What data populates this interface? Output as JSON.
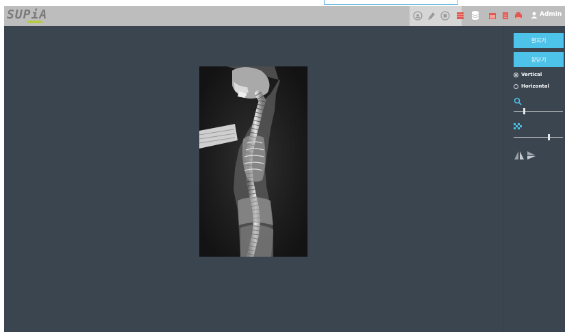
{
  "app": {
    "logo_text": "SUPiA"
  },
  "header": {
    "user_label": "Admin",
    "icons": [
      "eject-icon",
      "eraser-icon",
      "stop-icon",
      "film-icon",
      "database-icon",
      "calendar-icon",
      "document-icon",
      "print-icon",
      "user-icon"
    ]
  },
  "panel": {
    "open_label": "펼치기",
    "close_label": "창닫기",
    "orientation_options": [
      "Vertical",
      "Horizontal"
    ],
    "orientation_selected": "Vertical",
    "zoom_level": 0.2,
    "contrast_level": 0.72,
    "tool_icons": [
      "flip-horizontal-icon",
      "flip-vertical-icon"
    ]
  },
  "colors": {
    "accent": "#4dc3ea",
    "viewport_bg": "#3a4550",
    "header_bg": "#bdbdbd",
    "icon_red": "#e0584f"
  }
}
